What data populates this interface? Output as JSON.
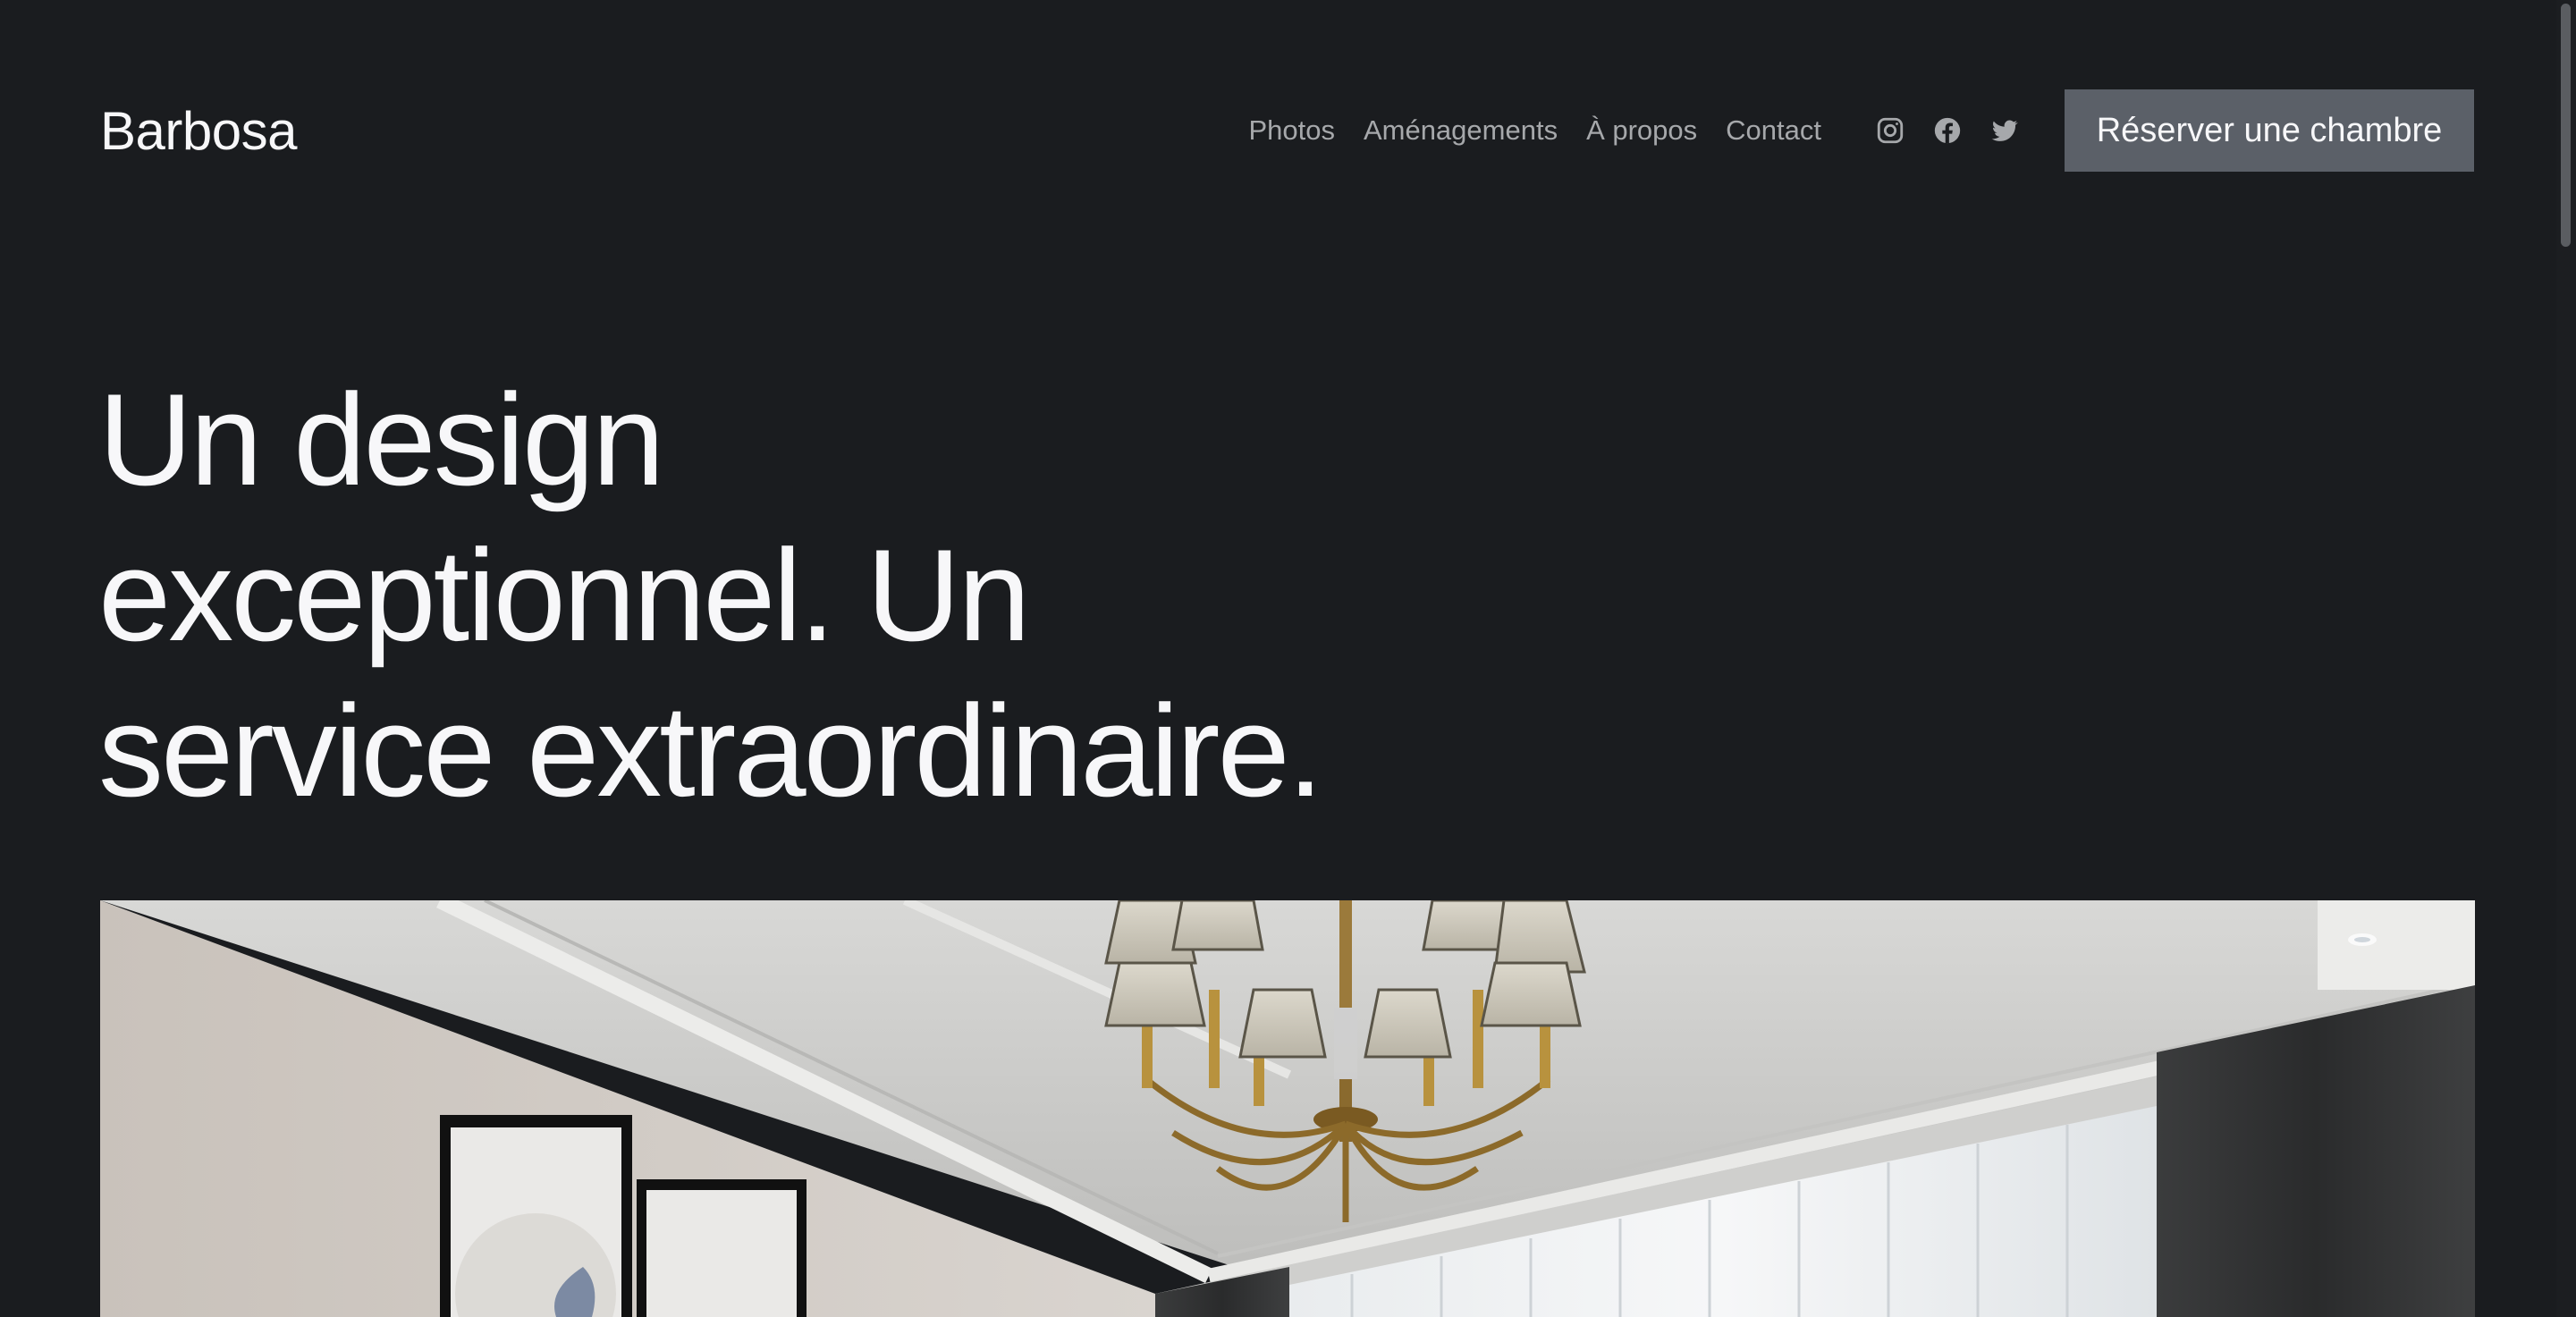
{
  "header": {
    "brand": "Barbosa",
    "nav": [
      {
        "label": "Photos"
      },
      {
        "label": "Aménagements"
      },
      {
        "label": "À propos"
      },
      {
        "label": "Contact"
      }
    ],
    "socials": [
      {
        "icon": "instagram-icon"
      },
      {
        "icon": "facebook-icon"
      },
      {
        "icon": "twitter-icon"
      }
    ],
    "cta_label": "Réserver une chambre"
  },
  "hero": {
    "title_lines": [
      "Un design",
      "exceptionnel. Un",
      "service extraordinaire."
    ],
    "image": "bedroom-photo"
  },
  "colors": {
    "background": "#1a1c1f",
    "text": "#f7f7f9",
    "nav_text": "#a6a8ab",
    "button_bg": "#5b6068"
  }
}
